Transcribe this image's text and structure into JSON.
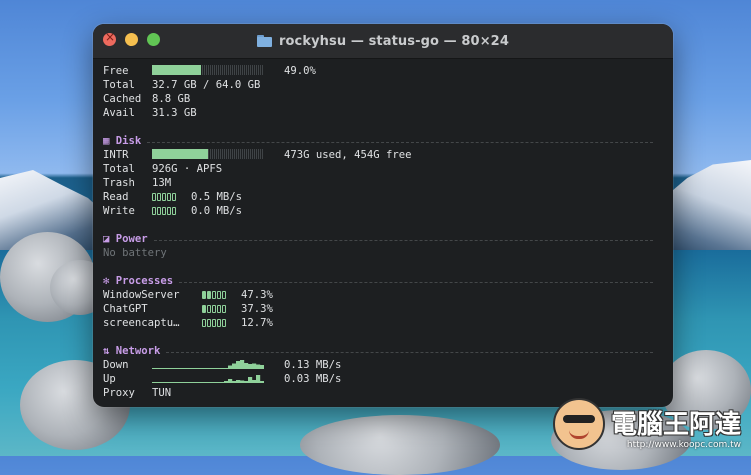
{
  "window": {
    "title": "rockyhsu — status-go — 80×24"
  },
  "memory": {
    "free": {
      "label": "Free",
      "value": "49.0%",
      "fraction": 0.44
    },
    "total": {
      "label": "Total",
      "value": "32.7 GB / 64.0 GB"
    },
    "cached": {
      "label": "Cached",
      "value": "8.8 GB"
    },
    "avail": {
      "label": "Avail",
      "value": "31.3 GB"
    }
  },
  "disk": {
    "header": "Disk",
    "header_icon": "square-icon",
    "intr": {
      "label": "INTR",
      "value": "473G used, 454G free",
      "fraction": 0.5
    },
    "total": {
      "label": "Total",
      "value": "926G · APFS"
    },
    "trash": {
      "label": "Trash",
      "value": "13M"
    },
    "read": {
      "label": "Read",
      "value": "0.5 MB/s",
      "ticks_on": 0
    },
    "write": {
      "label": "Write",
      "value": "0.0 MB/s",
      "ticks_on": 0
    }
  },
  "power": {
    "header": "Power",
    "header_icon": "battery-icon",
    "status": "No battery"
  },
  "processes": {
    "header": "Processes",
    "header_icon": "asterisk-icon",
    "items": [
      {
        "name": "WindowServer",
        "value": "47.3%",
        "ticks_on": 2
      },
      {
        "name": "ChatGPT",
        "value": "37.3%",
        "ticks_on": 1
      },
      {
        "name": "screencaptu…",
        "value": "12.7%",
        "ticks_on": 0
      }
    ]
  },
  "network": {
    "header": "Network",
    "header_icon": "arrows-updown-icon",
    "down": {
      "label": "Down",
      "value": "0.13 MB/s",
      "history": [
        0.05,
        0.05,
        0.05,
        0.05,
        0.05,
        0.05,
        0.05,
        0.05,
        0.05,
        0.05,
        0.05,
        0.05,
        0.05,
        0.05,
        0.05,
        0.05,
        0.05,
        0.08,
        0.1,
        0.35,
        0.55,
        0.8,
        0.9,
        0.6,
        0.5,
        0.55,
        0.45,
        0.4
      ]
    },
    "up": {
      "label": "Up",
      "value": "0.03 MB/s",
      "history": [
        0.05,
        0.05,
        0.05,
        0.05,
        0.05,
        0.05,
        0.05,
        0.05,
        0.05,
        0.05,
        0.05,
        0.05,
        0.05,
        0.05,
        0.05,
        0.05,
        0.05,
        0.05,
        0.2,
        0.4,
        0.2,
        0.3,
        0.25,
        0.2,
        0.6,
        0.3,
        0.8,
        0.2
      ]
    },
    "proxy": {
      "label": "Proxy",
      "value": "TUN"
    }
  },
  "watermark": {
    "brand": "電腦王阿達",
    "url": "http://www.koopc.com.tw"
  },
  "colors": {
    "accent": "#8fd19a",
    "section": "#c89de8"
  }
}
